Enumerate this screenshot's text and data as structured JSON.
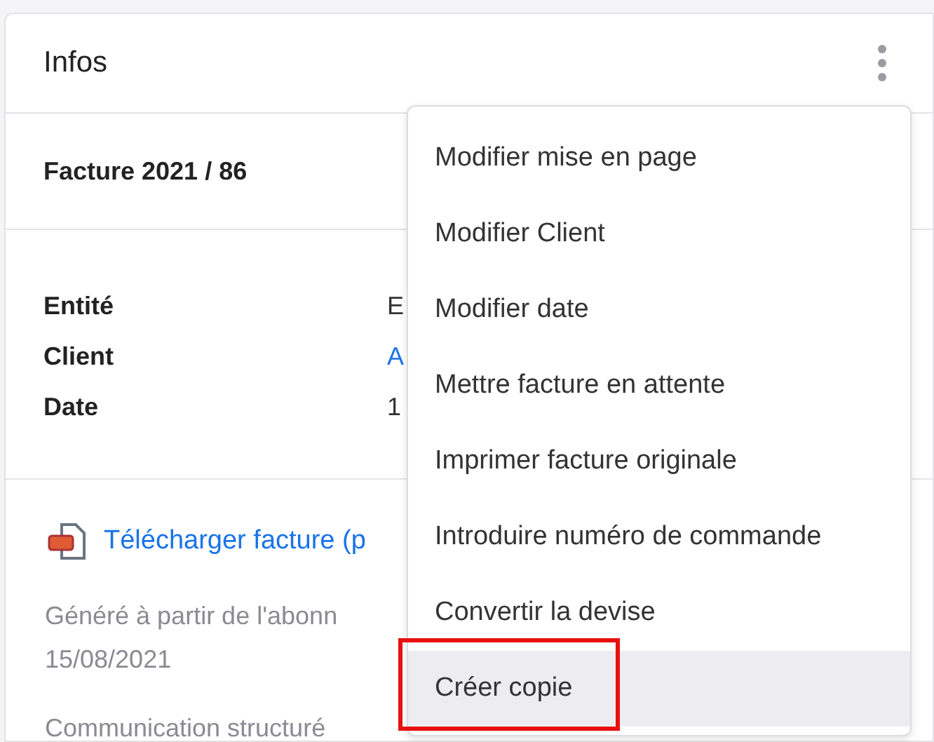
{
  "card": {
    "title": "Infos",
    "invoice_title": "Facture 2021 / 86",
    "details": [
      {
        "label": "Entité",
        "value": "E",
        "kind": "text"
      },
      {
        "label": "Client",
        "value": "A",
        "kind": "link"
      },
      {
        "label": "Date",
        "value": "1",
        "kind": "text"
      }
    ],
    "download_link": "Télécharger facture (p",
    "generated_note": [
      "Généré à partir de l'abonn",
      "15/08/2021"
    ],
    "footer_text": "Communication structuré"
  },
  "menu": {
    "items": [
      {
        "label": "Modifier mise en page",
        "selected": false,
        "outlined": false
      },
      {
        "label": "Modifier Client",
        "selected": false,
        "outlined": false
      },
      {
        "label": "Modifier date",
        "selected": false,
        "outlined": false
      },
      {
        "label": "Mettre facture en attente",
        "selected": false,
        "outlined": false
      },
      {
        "label": "Imprimer facture originale",
        "selected": false,
        "outlined": false
      },
      {
        "label": "Introduire numéro de commande",
        "selected": false,
        "outlined": false
      },
      {
        "label": "Convertir la devise",
        "selected": false,
        "outlined": false
      },
      {
        "label": "Créer copie",
        "selected": true,
        "outlined": true
      }
    ]
  }
}
